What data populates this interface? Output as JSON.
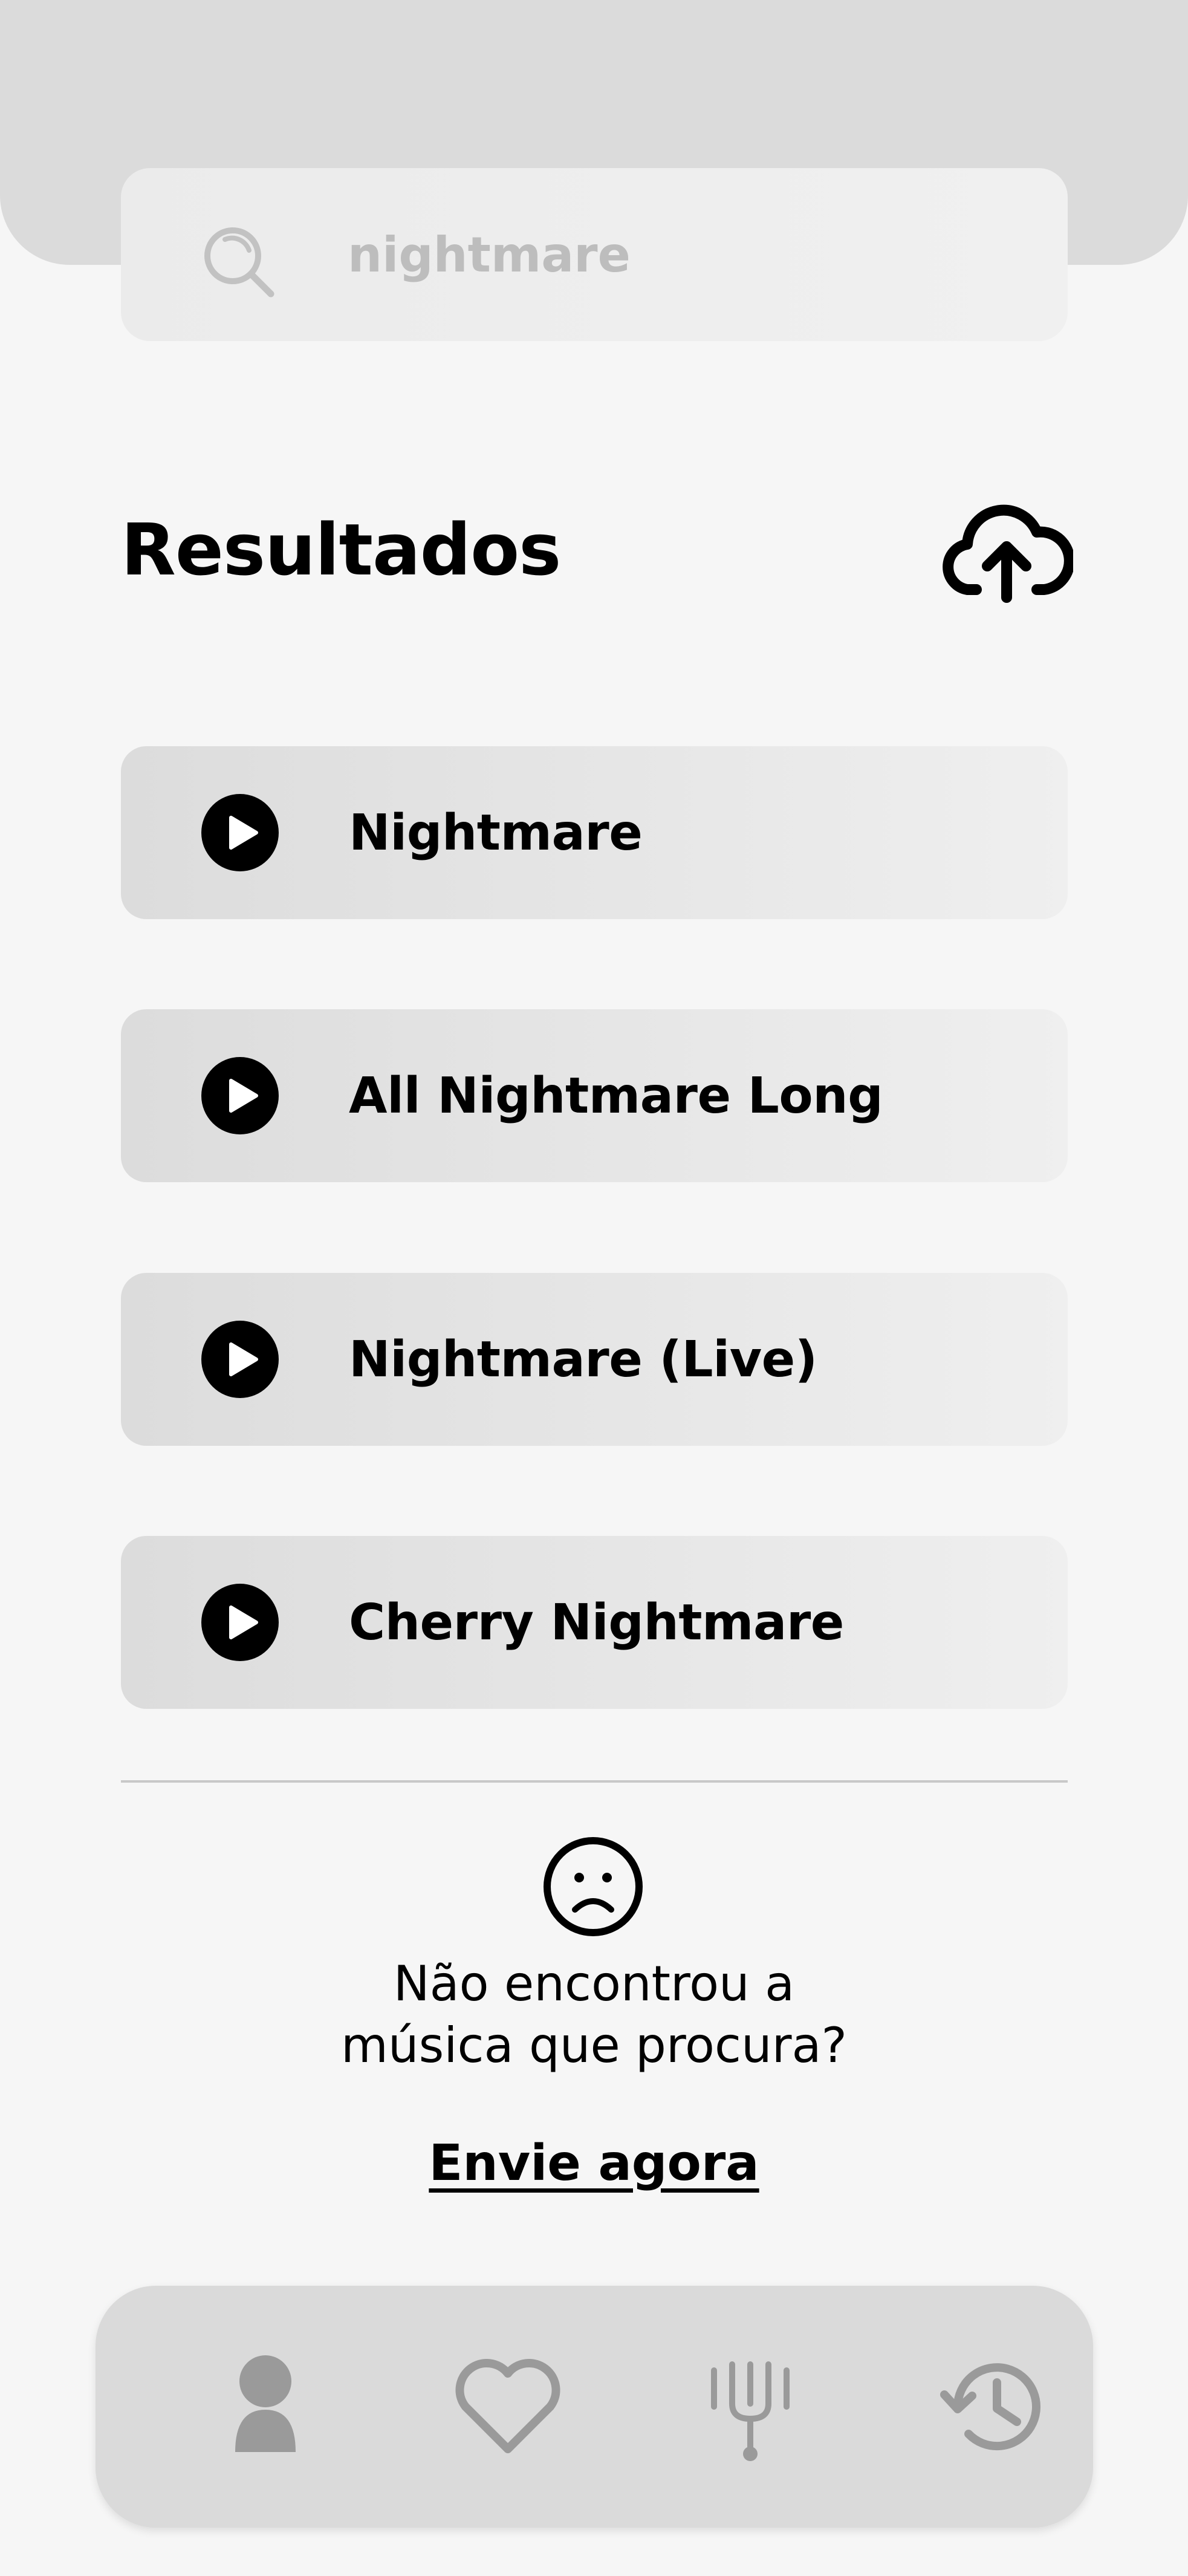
{
  "search": {
    "value": "nightmare",
    "icon": "search-icon"
  },
  "results_section": {
    "title": "Resultados",
    "upload_icon": "cloud-upload-icon",
    "items": [
      {
        "label": "Nightmare",
        "icon": "play-icon"
      },
      {
        "label": "All Nightmare Long",
        "icon": "play-icon"
      },
      {
        "label": "Nightmare (Live)",
        "icon": "play-icon"
      },
      {
        "label": "Cherry Nightmare",
        "icon": "play-icon"
      }
    ]
  },
  "not_found": {
    "icon": "sad-face-icon",
    "line1": "Não encontrou a",
    "line2": "música que procura?",
    "link": "Envie agora"
  },
  "bottom_nav": {
    "items": [
      {
        "name": "profile",
        "icon": "user-icon"
      },
      {
        "name": "favorites",
        "icon": "heart-icon"
      },
      {
        "name": "tuning",
        "icon": "tuning-fork-icon"
      },
      {
        "name": "history",
        "icon": "history-icon"
      }
    ]
  },
  "colors": {
    "background": "#f6f6f6",
    "top_band": "#dbdbdb",
    "card": "#e4e4e4",
    "placeholder_text": "#bdbdbd",
    "nav_icon": "#9a9a9a",
    "nav_bar": "#dadada"
  }
}
